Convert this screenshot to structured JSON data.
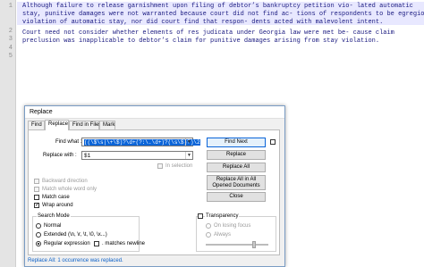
{
  "editor": {
    "line_numbers": [
      "1",
      "2",
      "3",
      "4",
      "5"
    ],
    "lines": [
      "Although failure to release garnishment upon filing of debtor’s bankruptcy petition vio- lated automatic",
      "stay, punitive damages were not warranted because court did not find ac- tions of respondents to be egregious",
      "violation of automatic stay, nor did court find that respon- dents acted with malevolent intent.",
      "",
      "Court need not consider whether elements of res judicata under Georgia law were met be- cause claim",
      "preclusion was inapplicable to debtor’s claim for punitive damages arising from stay violation."
    ]
  },
  "dialog": {
    "title": "Replace",
    "tabs": [
      "Find",
      "Replace",
      "Find in Files",
      "Mark"
    ],
    "find_label": "Find what :",
    "find_value": "((\\$\\s|\\+\\$)?\\d+(?:\\.\\d+)?(\\s\\$)?)\\2",
    "replace_label": "Replace with :",
    "replace_value": "$1",
    "in_selection": "In selection",
    "buttons": {
      "find_next": "Find Next",
      "replace": "Replace",
      "replace_all": "Replace All",
      "replace_all_opened": "Replace All in All Opened Documents",
      "close": "Close"
    },
    "options": {
      "backward": "Backward direction",
      "whole_word": "Match whole word only",
      "match_case": "Match case",
      "wrap_around": "Wrap around"
    },
    "search_mode": {
      "title": "Search Mode",
      "normal": "Normal",
      "extended": "Extended (\\n, \\r, \\t, \\0, \\x...)",
      "regex": "Regular expression",
      "matches_newline": ". matches newline"
    },
    "transparency": {
      "title": "Transparency",
      "on_losing_focus": "On losing focus",
      "always": "Always"
    },
    "status": "Replace All: 1 occurrence was replaced."
  }
}
